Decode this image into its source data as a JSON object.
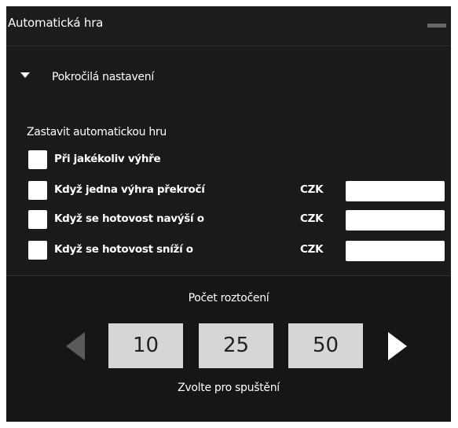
{
  "window": {
    "title": "Automatická hra"
  },
  "advanced": {
    "label": "Pokročilá nastavení",
    "expanded": true
  },
  "stop_autoplay": {
    "title": "Zastavit automatickou hru",
    "options": [
      {
        "label": "Při jakékoliv výhře",
        "checked": false
      },
      {
        "label": "Když jedna výhra překročí",
        "checked": false,
        "currency": "CZK",
        "value": ""
      },
      {
        "label": "Když se hotovost navýší o",
        "checked": false,
        "currency": "CZK",
        "value": ""
      },
      {
        "label": "Když se hotovost sníží o",
        "checked": false,
        "currency": "CZK",
        "value": ""
      }
    ]
  },
  "spins": {
    "title": "Počet roztočení",
    "options": [
      "10",
      "25",
      "50"
    ],
    "hint": "Zvolte pro spuštění"
  },
  "colors": {
    "panel_bg": "#1a1a1a",
    "bottom_bg": "#161616",
    "button_bg": "#d6d6d6",
    "arrow_disabled": "#5a5a5a",
    "text": "#ffffff"
  },
  "icons": {
    "minimize": "minimize-icon",
    "expand": "triangle-down-icon",
    "prev": "arrow-left-icon",
    "next": "arrow-right-icon"
  }
}
